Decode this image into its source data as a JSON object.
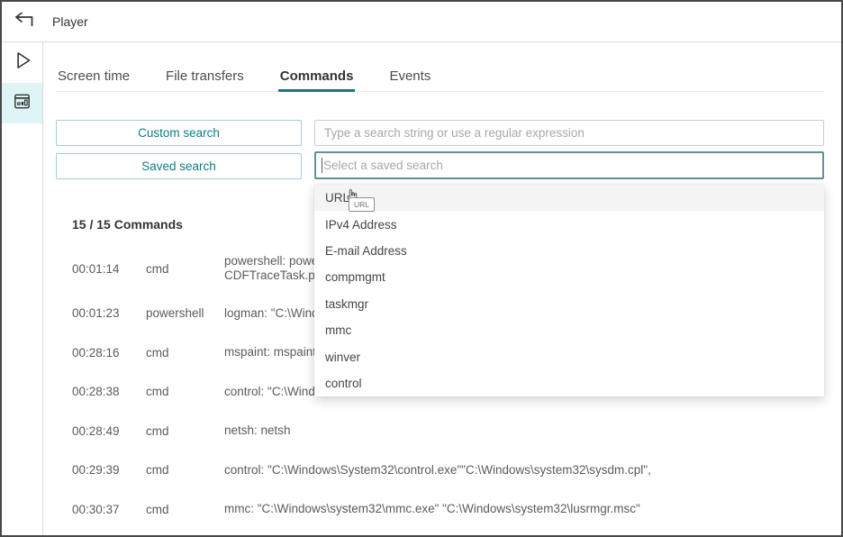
{
  "header": {
    "title": "Player"
  },
  "sidebar": {
    "items": [
      {
        "icon": "play-icon",
        "active": false
      },
      {
        "icon": "statistics-icon",
        "active": true
      }
    ]
  },
  "tabs": [
    {
      "label": "Screen time",
      "active": false
    },
    {
      "label": "File transfers",
      "active": false
    },
    {
      "label": "Commands",
      "active": true
    },
    {
      "label": "Events",
      "active": false
    }
  ],
  "search": {
    "custom_button": "Custom search",
    "saved_button": "Saved search",
    "query_placeholder": "Type a search string or use a regular expression",
    "saved_placeholder": "Select a saved search"
  },
  "dropdown": {
    "items": [
      {
        "label": "URL",
        "hovered": true,
        "tooltip": "URL"
      },
      {
        "label": "IPv4 Address",
        "hovered": false
      },
      {
        "label": "E-mail Address",
        "hovered": false
      },
      {
        "label": "compmgmt",
        "hovered": false
      },
      {
        "label": "taskmgr",
        "hovered": false
      },
      {
        "label": "mmc",
        "hovered": false
      },
      {
        "label": "winver",
        "hovered": false
      },
      {
        "label": "control",
        "hovered": false
      }
    ]
  },
  "commands": {
    "count_label": "15 / 15 Commands",
    "rows": [
      {
        "time": "00:01:14",
        "app": "cmd",
        "command": "powershell: power\nCDFTraceTask.ps1"
      },
      {
        "time": "00:01:23",
        "app": "powershell",
        "command": "logman: \"C:\\Windo"
      },
      {
        "time": "00:28:16",
        "app": "cmd",
        "command": "mspaint: mspaint"
      },
      {
        "time": "00:28:38",
        "app": "cmd",
        "command": "control: \"C:\\Windo"
      },
      {
        "time": "00:28:49",
        "app": "cmd",
        "command": "netsh: netsh"
      },
      {
        "time": "00:29:39",
        "app": "cmd",
        "command": "control: \"C:\\Windows\\System32\\control.exe\"\"C:\\Windows\\system32\\sysdm.cpl\","
      },
      {
        "time": "00:30:37",
        "app": "cmd",
        "command": "mmc: \"C:\\Windows\\system32\\mmc.exe\" \"C:\\Windows\\system32\\lusrmgr.msc\""
      }
    ]
  },
  "colors": {
    "accent": "#0d7c84",
    "button_border": "#a3ced4",
    "focused_input_border": "#5f929b",
    "active_tile_bg": "#dff4f5"
  }
}
